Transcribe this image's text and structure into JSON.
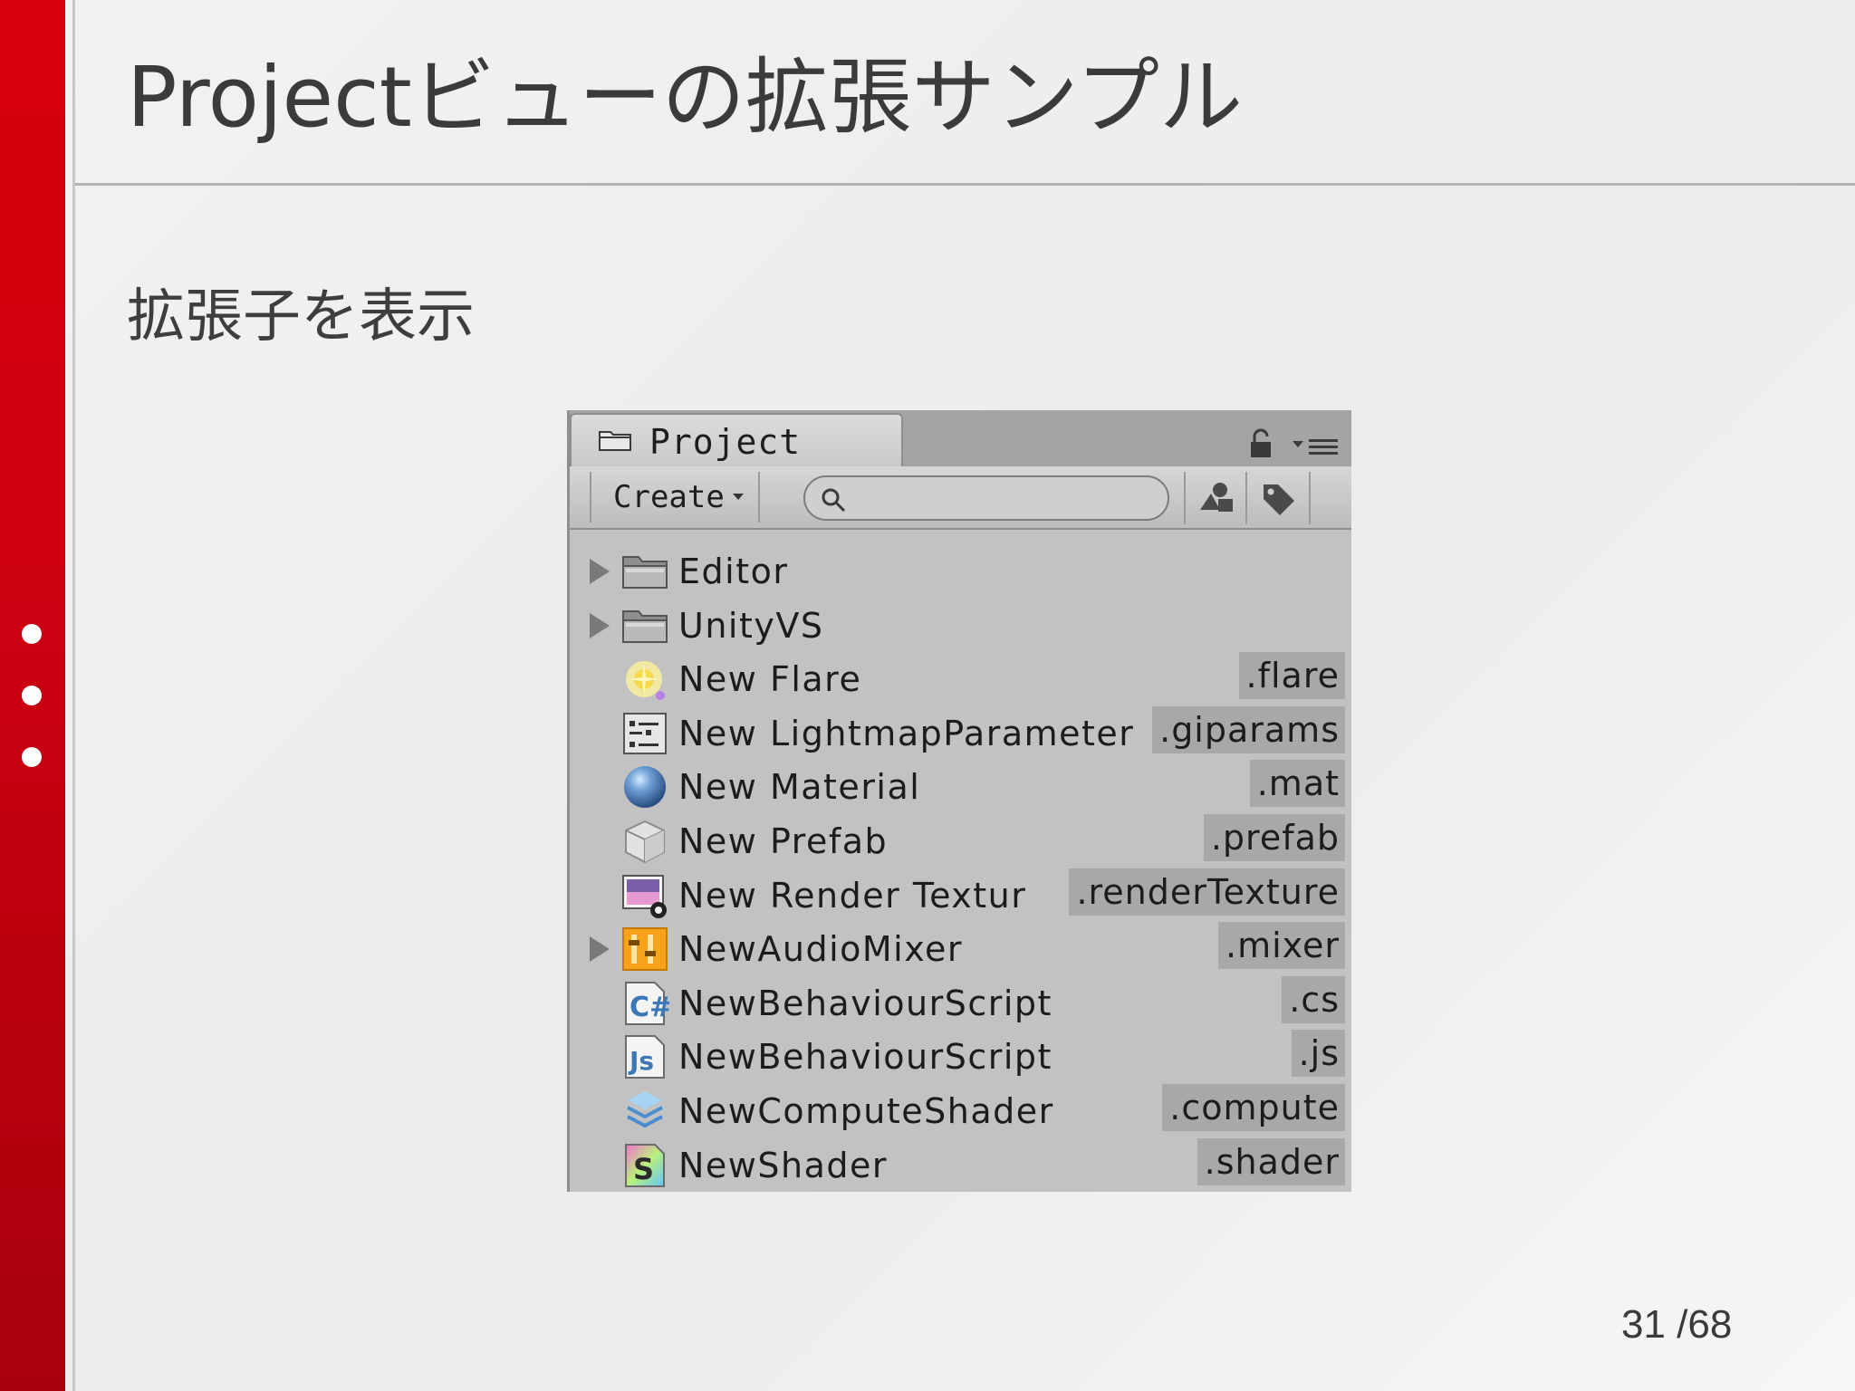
{
  "slide": {
    "title": "Projectビューの拡張サンプル",
    "subtitle": "拡張子を表示",
    "page_number": "31 /68"
  },
  "project_window": {
    "tab_label": "Project",
    "create_label": "Create",
    "search_placeholder": "",
    "icons": [
      "folder-icon",
      "lock-icon",
      "tab-menu-icon",
      "search-icon",
      "filter-by-type-icon",
      "filter-by-label-icon"
    ],
    "assets": [
      {
        "name": "Editor",
        "ext": "",
        "icon": "folder-icon",
        "foldable": true
      },
      {
        "name": "UnityVS",
        "ext": "",
        "icon": "folder-icon",
        "foldable": true
      },
      {
        "name": "New Flare",
        "ext": ".flare",
        "icon": "flare-icon",
        "foldable": false
      },
      {
        "name": "New LightmapParameter",
        "ext": ".giparams",
        "icon": "lightmap-parameters-icon",
        "foldable": false
      },
      {
        "name": "New Material",
        "ext": ".mat",
        "icon": "material-icon",
        "foldable": false
      },
      {
        "name": "New Prefab",
        "ext": ".prefab",
        "icon": "prefab-icon",
        "foldable": false
      },
      {
        "name": "New Render Textur",
        "ext": ".renderTexture",
        "icon": "render-texture-icon",
        "foldable": false
      },
      {
        "name": "NewAudioMixer",
        "ext": ".mixer",
        "icon": "audio-mixer-icon",
        "foldable": true
      },
      {
        "name": "NewBehaviourScript",
        "ext": ".cs",
        "icon": "csharp-script-icon",
        "foldable": false
      },
      {
        "name": "NewBehaviourScript",
        "ext": ".js",
        "icon": "js-script-icon",
        "foldable": false
      },
      {
        "name": "NewComputeShader",
        "ext": ".compute",
        "icon": "compute-shader-icon",
        "foldable": false
      },
      {
        "name": "NewShader",
        "ext": ".shader",
        "icon": "shader-icon",
        "foldable": false
      }
    ]
  },
  "colors": {
    "accent_red": "#d9000c",
    "panel_gray": "#c2c2c2",
    "extension_highlight": "#a8a8a8"
  }
}
